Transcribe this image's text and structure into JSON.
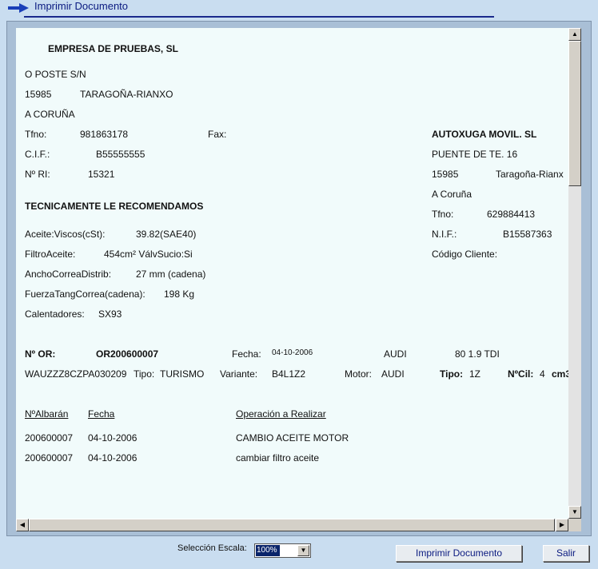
{
  "window": {
    "title": "Imprimir Documento"
  },
  "company": {
    "name": "EMPRESA DE PRUEBAS, SL",
    "address": "O POSTE S/N",
    "postal_code": "15985",
    "city": "TARAGOÑA-RIANXO",
    "province": "A CORUÑA",
    "phone_label": "Tfno:",
    "phone": "981863178",
    "fax_label": "Fax:",
    "cif_label": "C.I.F.:",
    "cif": "B55555555",
    "ri_label": "Nº RI:",
    "ri": "15321"
  },
  "customer": {
    "name": "AUTOXUGA MOVIL. SL",
    "address": "PUENTE DE TE. 16",
    "postal_code": "15985",
    "city": "Taragoña-Rianx",
    "province": "A Coruña",
    "phone_label": "Tfno:",
    "phone": "629884413",
    "nif_label": "N.I.F.:",
    "nif": "B15587363",
    "client_code_label": "Código Cliente:"
  },
  "recommendations": {
    "heading": "TECNICAMENTE LE RECOMENDAMOS",
    "oil_label": "Aceite:Viscos(cSt):",
    "oil_value": "39.82(SAE40)",
    "filter_label": "FiltroAceite:",
    "filter_value": "454cm²  VálvSucio:Si",
    "belt_width_label": "AnchoCorreaDistrib:",
    "belt_width_value": "27 mm    (cadena)",
    "belt_force_label": "FuerzaTangCorrea(cadena):",
    "belt_force_value": "198 Kg",
    "heaters_label": "Calentadores:",
    "heaters_value": "SX93"
  },
  "order": {
    "or_label": "Nº OR:",
    "or_value": "OR200600007",
    "date_label": "Fecha:",
    "date_value": "04-10-2006",
    "brand": "AUDI",
    "model": "80 1.9 TDI",
    "vin": "WAUZZZ8CZPA030209",
    "type_label": "Tipo:",
    "type_value": "TURISMO",
    "variant_label": "Variante:",
    "variant_value": "B4L1Z2",
    "motor_label": "Motor:",
    "motor_value": "AUDI",
    "tipo2_label": "Tipo:",
    "tipo2_value": "1Z",
    "cyl_label": "NºCil:",
    "cyl_value": "4",
    "cm3_label": "cm3"
  },
  "operations_table": {
    "headers": [
      "NºAlbarán",
      "Fecha",
      "Operación a Realizar"
    ],
    "rows": [
      [
        "200600007",
        "04-10-2006",
        "CAMBIO ACEITE MOTOR"
      ],
      [
        "200600007",
        "04-10-2006",
        "cambiar filtro aceite"
      ]
    ]
  },
  "footer": {
    "scale_label": "Selección Escala:",
    "scale_value": "100%",
    "print_button": "Imprimir Documento",
    "exit_button": "Salir"
  },
  "colors": {
    "background": "#c9ddf0",
    "document": "#f1fbfb",
    "title_text": "#0a1a80"
  }
}
